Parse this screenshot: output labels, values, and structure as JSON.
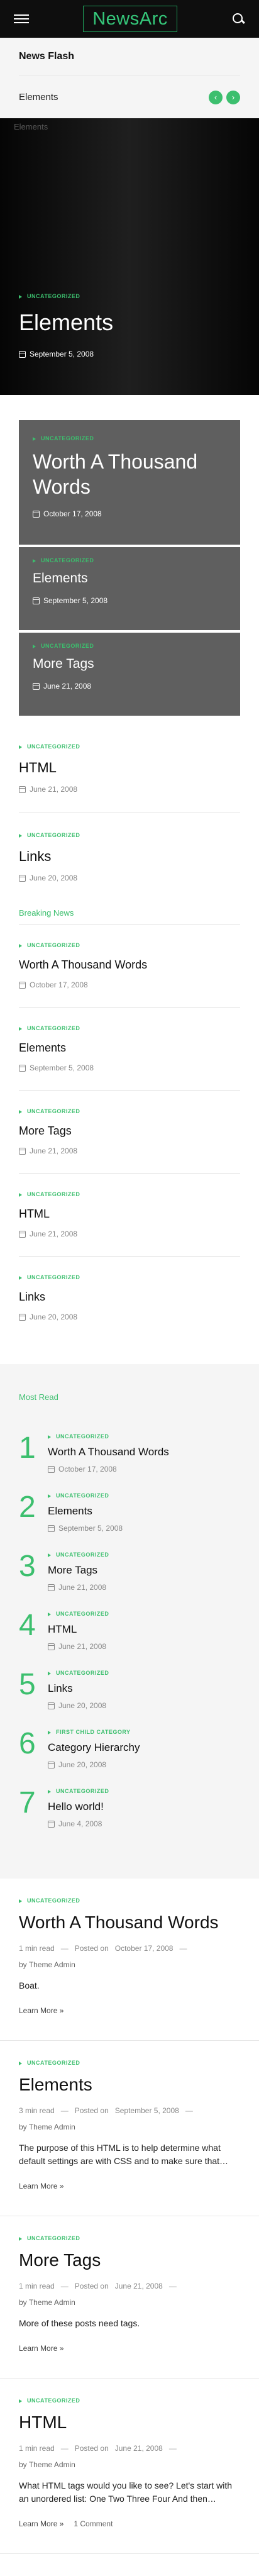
{
  "brand": {
    "logo": "NewsArc",
    "accent": "#3cbf6e"
  },
  "flash": {
    "title": "News Flash",
    "current": "Elements",
    "prev": "‹",
    "next": "›"
  },
  "hero": {
    "ghost": "Elements",
    "category": "UNCATEGORIZED",
    "title": "Elements",
    "date": "September 5, 2008"
  },
  "cards": [
    {
      "category": "UNCATEGORIZED",
      "title": "Worth A Thousand Words",
      "date": "October 17, 2008"
    },
    {
      "category": "UNCATEGORIZED",
      "title": "Elements",
      "date": "September 5, 2008"
    },
    {
      "category": "UNCATEGORIZED",
      "title": "More Tags",
      "date": "June 21, 2008"
    }
  ],
  "list1": [
    {
      "category": "UNCATEGORIZED",
      "title": "HTML",
      "date": "June 21, 2008"
    },
    {
      "category": "UNCATEGORIZED",
      "title": "Links",
      "date": "June 20, 2008"
    }
  ],
  "breaking": {
    "title": "Breaking News",
    "items": [
      {
        "category": "UNCATEGORIZED",
        "title": "Worth A Thousand Words",
        "date": "October 17, 2008"
      },
      {
        "category": "UNCATEGORIZED",
        "title": "Elements",
        "date": "September 5, 2008"
      },
      {
        "category": "UNCATEGORIZED",
        "title": "More Tags",
        "date": "June 21, 2008"
      },
      {
        "category": "UNCATEGORIZED",
        "title": "HTML",
        "date": "June 21, 2008"
      },
      {
        "category": "UNCATEGORIZED",
        "title": "Links",
        "date": "June 20, 2008"
      }
    ]
  },
  "most_read": {
    "title": "Most Read",
    "items": [
      {
        "num": "1",
        "category": "UNCATEGORIZED",
        "title": "Worth A Thousand Words",
        "date": "October 17, 2008"
      },
      {
        "num": "2",
        "category": "UNCATEGORIZED",
        "title": "Elements",
        "date": "September 5, 2008"
      },
      {
        "num": "3",
        "category": "UNCATEGORIZED",
        "title": "More Tags",
        "date": "June 21, 2008"
      },
      {
        "num": "4",
        "category": "UNCATEGORIZED",
        "title": "HTML",
        "date": "June 21, 2008"
      },
      {
        "num": "5",
        "category": "UNCATEGORIZED",
        "title": "Links",
        "date": "June 20, 2008"
      },
      {
        "num": "6",
        "category": "FIRST CHILD CATEGORY",
        "title": "Category Hierarchy",
        "date": "June 20, 2008"
      },
      {
        "num": "7",
        "category": "UNCATEGORIZED",
        "title": "Hello world!",
        "date": "June 4, 2008"
      }
    ]
  },
  "articles": [
    {
      "category": "UNCATEGORIZED",
      "title": "Worth A Thousand Words",
      "read": "1 min read",
      "posted": "Posted on",
      "date": "October 17, 2008",
      "by": "by",
      "author": "Theme Admin",
      "excerpt": "Boat.",
      "more": "Learn More »",
      "comments": ""
    },
    {
      "category": "UNCATEGORIZED",
      "title": "Elements",
      "read": "3 min read",
      "posted": "Posted on",
      "date": "September 5, 2008",
      "by": "by",
      "author": "Theme Admin",
      "excerpt": "The purpose of this HTML is to help determine what default settings are with CSS and to make sure that…",
      "more": "Learn More »",
      "comments": ""
    },
    {
      "category": "UNCATEGORIZED",
      "title": "More Tags",
      "read": "1 min read",
      "posted": "Posted on",
      "date": "June 21, 2008",
      "by": "by",
      "author": "Theme Admin",
      "excerpt": "More of these posts need tags.",
      "more": "Learn More »",
      "comments": ""
    },
    {
      "category": "UNCATEGORIZED",
      "title": "HTML",
      "read": "1 min read",
      "posted": "Posted on",
      "date": "June 21, 2008",
      "by": "by",
      "author": "Theme Admin",
      "excerpt": "What HTML tags would you like to see? Let's start with an unordered list: One Two Three Four And then…",
      "more": "Learn More »",
      "comments": "1 Comment"
    }
  ]
}
